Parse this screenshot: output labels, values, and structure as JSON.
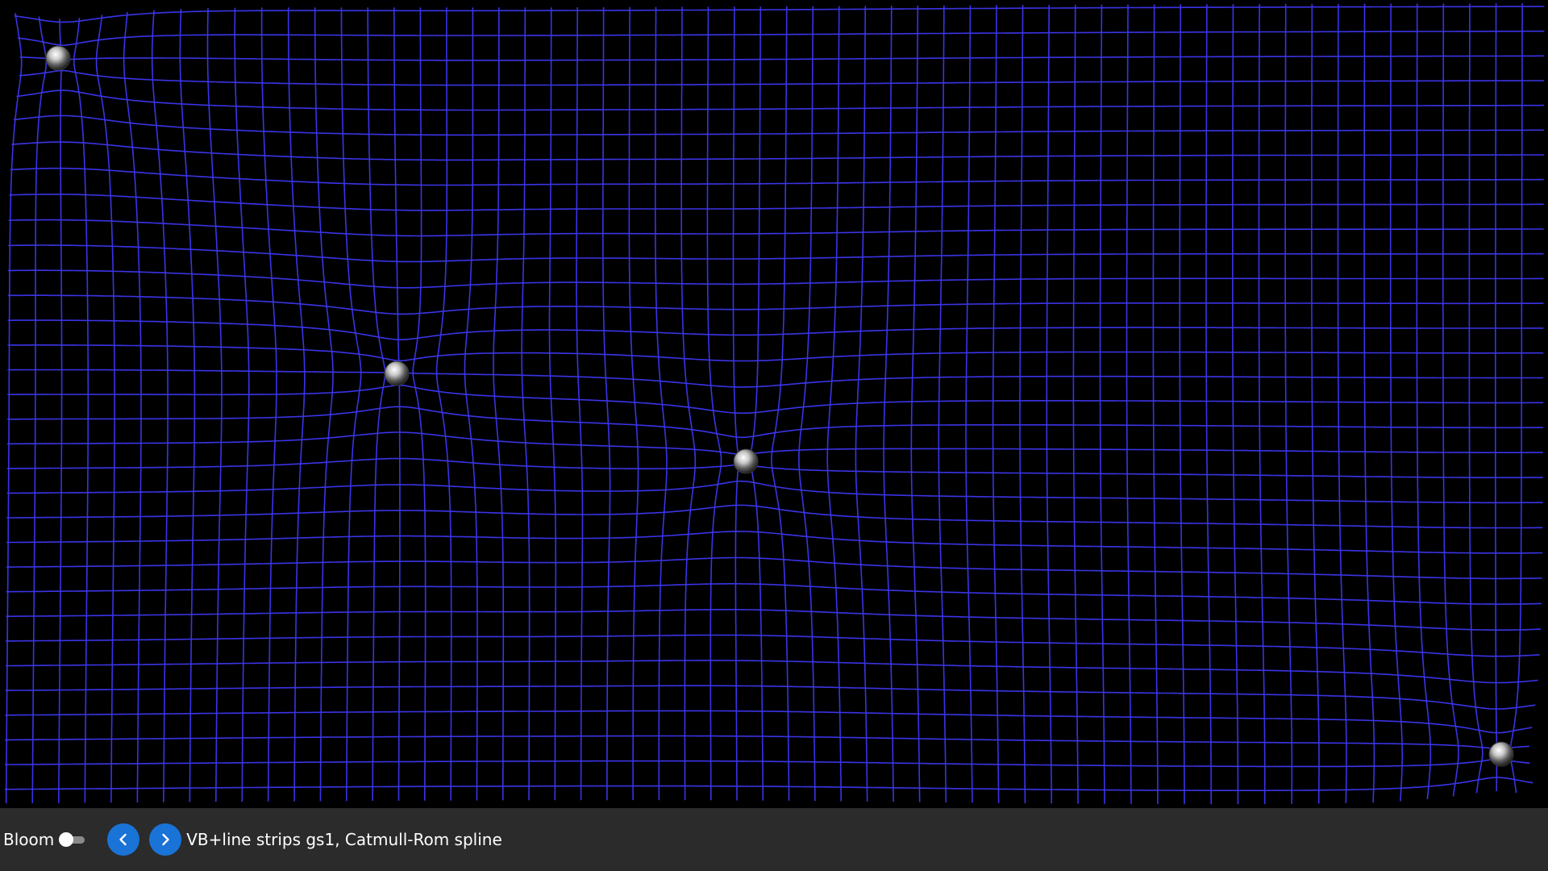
{
  "toolbar": {
    "bloom_label": "Bloom",
    "bloom_enabled": false,
    "prev_icon": "chevron-left-icon",
    "next_icon": "chevron-right-icon",
    "status": "VB+line strips gs1, Catmull-Rom spline"
  },
  "scene": {
    "background": "#000000",
    "grid_color": "#3a34e6",
    "toolbar_background": "#2b2b2b",
    "accent": "#1a73d6",
    "ball_count": 5
  }
}
